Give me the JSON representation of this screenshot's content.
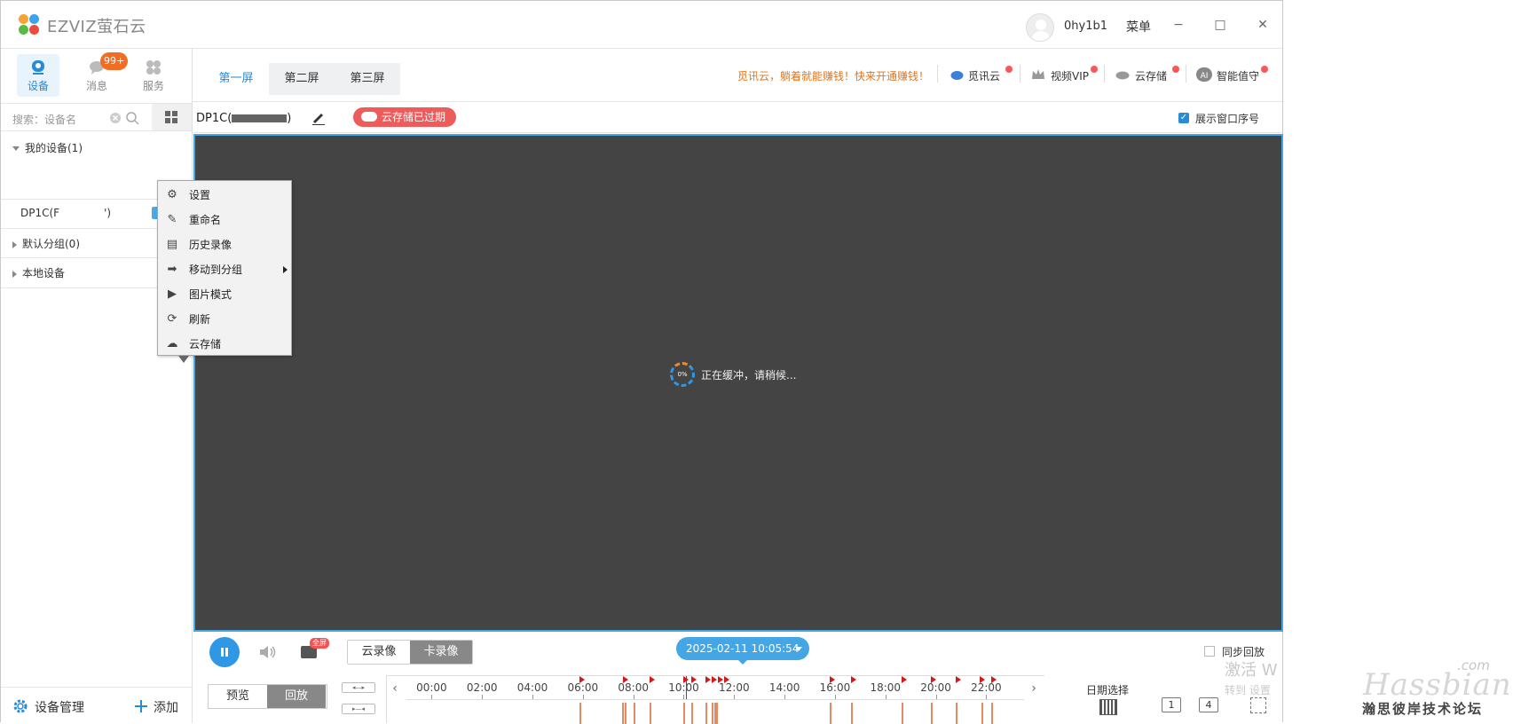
{
  "app": {
    "brand": "EZVIZ萤石云",
    "username": "0hy1b1",
    "menu_label": "菜单",
    "minimize": "−",
    "maximize": "□",
    "close": "✕"
  },
  "nav": {
    "device": "设备",
    "messages": "消息",
    "messages_badge": "99+",
    "services": "服务"
  },
  "search": {
    "placeholder": "搜索：设备名"
  },
  "tree": {
    "my_devices": "我的设备(1)",
    "device_name": "DP1C(F",
    "device_suffix": "')",
    "default_group": "默认分组(0)",
    "local_devices": "本地设备"
  },
  "sidebar_footer": {
    "device_management": "设备管理",
    "add": "添加"
  },
  "context_menu": [
    {
      "icon": "gear-icon",
      "glyph": "⚙",
      "label": "设置"
    },
    {
      "icon": "pencil-icon",
      "glyph": "✎",
      "label": "重命名"
    },
    {
      "icon": "history-icon",
      "glyph": "▤",
      "label": "历史录像"
    },
    {
      "icon": "arrow-right-icon",
      "glyph": "➡",
      "label": "移动到分组"
    },
    {
      "icon": "image-icon",
      "glyph": "▶",
      "label": "图片模式"
    },
    {
      "icon": "refresh-icon",
      "glyph": "⟳",
      "label": "刷新"
    },
    {
      "icon": "cloud-icon",
      "glyph": "☁",
      "label": "云存储"
    }
  ],
  "screen_tabs": [
    "第一屏",
    "第二屏",
    "第三屏"
  ],
  "header": {
    "promo": "觅讯云，躺着就能赚钱！快来开通赚钱！",
    "links": [
      "觅讯云",
      "视频VIP",
      "云存储",
      "智能值守"
    ]
  },
  "subheader": {
    "device_title": "DP1C(",
    "device_title_suffix": ")",
    "cloud_expired": "云存储已过期",
    "show_index": "展示窗口序号"
  },
  "video": {
    "progress": "0%",
    "status": "正在缓冲，请稍候..."
  },
  "controls": {
    "fullscreen_badge": "全屏",
    "cloud_recording": "云录像",
    "card_recording": "卡录像",
    "datetime": "2025-02-11 10:05:54",
    "sync_playback": "同步回放",
    "preview": "预览",
    "playback": "回放",
    "date_select": "日期选择",
    "layout_1": "1",
    "layout_4": "4"
  },
  "timeline": {
    "ticks": [
      "00:00",
      "02:00",
      "04:00",
      "06:00",
      "08:00",
      "10:00",
      "12:00",
      "14:00",
      "16:00",
      "18:00",
      "20:00",
      "22:00"
    ],
    "event_hours": [
      5.85,
      7.6,
      8.65,
      10.0,
      10.3,
      10.85,
      11.1,
      11.35,
      11.6,
      15.8,
      16.65,
      18.65,
      19.8,
      20.8,
      21.75,
      22.2
    ],
    "record_hours": [
      5.85,
      7.55,
      7.65,
      8.0,
      8.65,
      10.0,
      10.3,
      10.85,
      11.1,
      11.2,
      11.3,
      15.8,
      16.65,
      18.65,
      19.8,
      20.8,
      21.8,
      22.2
    ],
    "cursor_hour": 10.1
  },
  "watermark": {
    "activate_line1": "激活 W",
    "activate_line2": "转到 设置",
    "com": ".com",
    "main": "Hassbian",
    "sub": "瀚思彼岸技术论坛"
  }
}
